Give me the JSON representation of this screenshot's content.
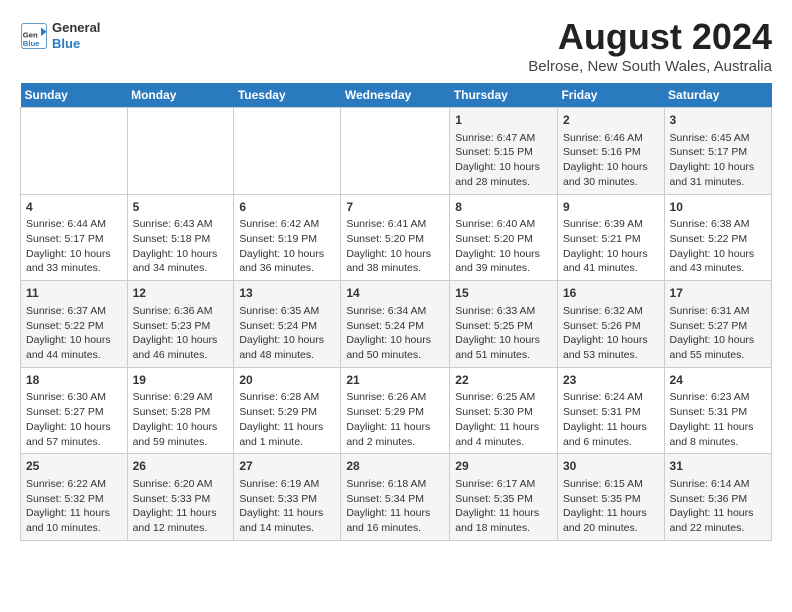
{
  "header": {
    "logo": {
      "general": "General",
      "blue": "Blue"
    },
    "title": "August 2024",
    "subtitle": "Belrose, New South Wales, Australia"
  },
  "days_of_week": [
    "Sunday",
    "Monday",
    "Tuesday",
    "Wednesday",
    "Thursday",
    "Friday",
    "Saturday"
  ],
  "weeks": [
    [
      {
        "day": "",
        "info": ""
      },
      {
        "day": "",
        "info": ""
      },
      {
        "day": "",
        "info": ""
      },
      {
        "day": "",
        "info": ""
      },
      {
        "day": "1",
        "info": "Sunrise: 6:47 AM\nSunset: 5:15 PM\nDaylight: 10 hours\nand 28 minutes."
      },
      {
        "day": "2",
        "info": "Sunrise: 6:46 AM\nSunset: 5:16 PM\nDaylight: 10 hours\nand 30 minutes."
      },
      {
        "day": "3",
        "info": "Sunrise: 6:45 AM\nSunset: 5:17 PM\nDaylight: 10 hours\nand 31 minutes."
      }
    ],
    [
      {
        "day": "4",
        "info": "Sunrise: 6:44 AM\nSunset: 5:17 PM\nDaylight: 10 hours\nand 33 minutes."
      },
      {
        "day": "5",
        "info": "Sunrise: 6:43 AM\nSunset: 5:18 PM\nDaylight: 10 hours\nand 34 minutes."
      },
      {
        "day": "6",
        "info": "Sunrise: 6:42 AM\nSunset: 5:19 PM\nDaylight: 10 hours\nand 36 minutes."
      },
      {
        "day": "7",
        "info": "Sunrise: 6:41 AM\nSunset: 5:20 PM\nDaylight: 10 hours\nand 38 minutes."
      },
      {
        "day": "8",
        "info": "Sunrise: 6:40 AM\nSunset: 5:20 PM\nDaylight: 10 hours\nand 39 minutes."
      },
      {
        "day": "9",
        "info": "Sunrise: 6:39 AM\nSunset: 5:21 PM\nDaylight: 10 hours\nand 41 minutes."
      },
      {
        "day": "10",
        "info": "Sunrise: 6:38 AM\nSunset: 5:22 PM\nDaylight: 10 hours\nand 43 minutes."
      }
    ],
    [
      {
        "day": "11",
        "info": "Sunrise: 6:37 AM\nSunset: 5:22 PM\nDaylight: 10 hours\nand 44 minutes."
      },
      {
        "day": "12",
        "info": "Sunrise: 6:36 AM\nSunset: 5:23 PM\nDaylight: 10 hours\nand 46 minutes."
      },
      {
        "day": "13",
        "info": "Sunrise: 6:35 AM\nSunset: 5:24 PM\nDaylight: 10 hours\nand 48 minutes."
      },
      {
        "day": "14",
        "info": "Sunrise: 6:34 AM\nSunset: 5:24 PM\nDaylight: 10 hours\nand 50 minutes."
      },
      {
        "day": "15",
        "info": "Sunrise: 6:33 AM\nSunset: 5:25 PM\nDaylight: 10 hours\nand 51 minutes."
      },
      {
        "day": "16",
        "info": "Sunrise: 6:32 AM\nSunset: 5:26 PM\nDaylight: 10 hours\nand 53 minutes."
      },
      {
        "day": "17",
        "info": "Sunrise: 6:31 AM\nSunset: 5:27 PM\nDaylight: 10 hours\nand 55 minutes."
      }
    ],
    [
      {
        "day": "18",
        "info": "Sunrise: 6:30 AM\nSunset: 5:27 PM\nDaylight: 10 hours\nand 57 minutes."
      },
      {
        "day": "19",
        "info": "Sunrise: 6:29 AM\nSunset: 5:28 PM\nDaylight: 10 hours\nand 59 minutes."
      },
      {
        "day": "20",
        "info": "Sunrise: 6:28 AM\nSunset: 5:29 PM\nDaylight: 11 hours\nand 1 minute."
      },
      {
        "day": "21",
        "info": "Sunrise: 6:26 AM\nSunset: 5:29 PM\nDaylight: 11 hours\nand 2 minutes."
      },
      {
        "day": "22",
        "info": "Sunrise: 6:25 AM\nSunset: 5:30 PM\nDaylight: 11 hours\nand 4 minutes."
      },
      {
        "day": "23",
        "info": "Sunrise: 6:24 AM\nSunset: 5:31 PM\nDaylight: 11 hours\nand 6 minutes."
      },
      {
        "day": "24",
        "info": "Sunrise: 6:23 AM\nSunset: 5:31 PM\nDaylight: 11 hours\nand 8 minutes."
      }
    ],
    [
      {
        "day": "25",
        "info": "Sunrise: 6:22 AM\nSunset: 5:32 PM\nDaylight: 11 hours\nand 10 minutes."
      },
      {
        "day": "26",
        "info": "Sunrise: 6:20 AM\nSunset: 5:33 PM\nDaylight: 11 hours\nand 12 minutes."
      },
      {
        "day": "27",
        "info": "Sunrise: 6:19 AM\nSunset: 5:33 PM\nDaylight: 11 hours\nand 14 minutes."
      },
      {
        "day": "28",
        "info": "Sunrise: 6:18 AM\nSunset: 5:34 PM\nDaylight: 11 hours\nand 16 minutes."
      },
      {
        "day": "29",
        "info": "Sunrise: 6:17 AM\nSunset: 5:35 PM\nDaylight: 11 hours\nand 18 minutes."
      },
      {
        "day": "30",
        "info": "Sunrise: 6:15 AM\nSunset: 5:35 PM\nDaylight: 11 hours\nand 20 minutes."
      },
      {
        "day": "31",
        "info": "Sunrise: 6:14 AM\nSunset: 5:36 PM\nDaylight: 11 hours\nand 22 minutes."
      }
    ]
  ]
}
